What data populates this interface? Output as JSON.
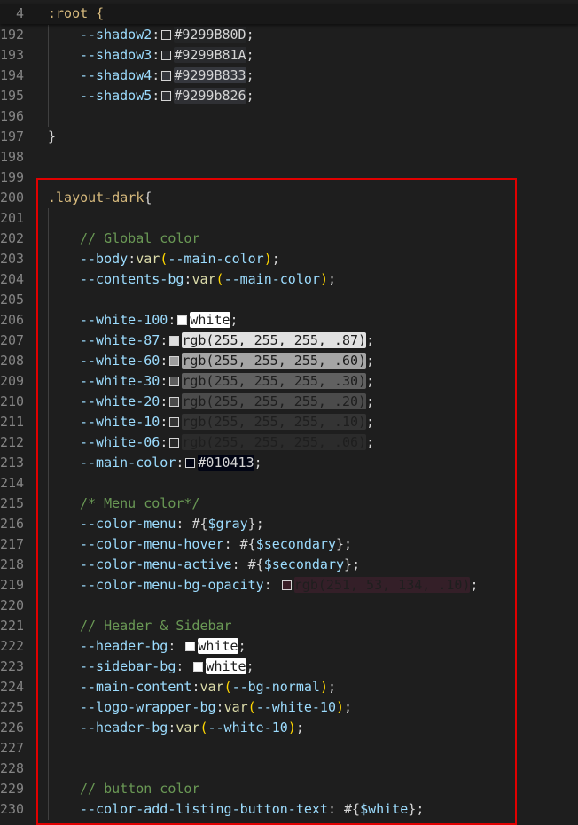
{
  "editor": {
    "sticky_line": {
      "number": "4",
      "text": ":root {"
    },
    "highlight_color": "#e00000",
    "lines": [
      {
        "n": "192",
        "indent": 1,
        "tokens": [
          {
            "t": "--shadow2",
            "c": "prop"
          },
          {
            "t": ":",
            "c": "punct"
          },
          {
            "swatch": "#9299B80D"
          },
          {
            "t": "#9299B80D",
            "c": "hex",
            "bg": "#9299B80D"
          },
          {
            "t": ";",
            "c": "punct"
          }
        ]
      },
      {
        "n": "193",
        "indent": 1,
        "tokens": [
          {
            "t": "--shadow3",
            "c": "prop"
          },
          {
            "t": ":",
            "c": "punct"
          },
          {
            "swatch": "#9299B81A"
          },
          {
            "t": "#9299B81A",
            "c": "hex",
            "bg": "#9299B81A"
          },
          {
            "t": ";",
            "c": "punct"
          }
        ]
      },
      {
        "n": "194",
        "indent": 1,
        "tokens": [
          {
            "t": "--shadow4",
            "c": "prop"
          },
          {
            "t": ":",
            "c": "punct"
          },
          {
            "swatch": "#9299B833"
          },
          {
            "t": "#9299B833",
            "c": "hex",
            "bg": "#9299B833"
          },
          {
            "t": ";",
            "c": "punct"
          }
        ]
      },
      {
        "n": "195",
        "indent": 1,
        "tokens": [
          {
            "t": "--shadow5",
            "c": "prop"
          },
          {
            "t": ":",
            "c": "punct"
          },
          {
            "swatch": "#9299b826"
          },
          {
            "t": "#9299b826",
            "c": "hex",
            "bg": "#9299b826"
          },
          {
            "t": ";",
            "c": "punct"
          }
        ]
      },
      {
        "n": "196",
        "indent": 0,
        "tokens": []
      },
      {
        "n": "197",
        "indent": 0,
        "tokens": [
          {
            "t": "}",
            "c": "brace"
          }
        ]
      },
      {
        "n": "198",
        "indent": 0,
        "tokens": []
      },
      {
        "n": "199",
        "indent": 0,
        "tokens": []
      },
      {
        "n": "200",
        "indent": 0,
        "tokens": [
          {
            "t": ".layout-dark",
            "c": "selector"
          },
          {
            "t": "{",
            "c": "brace"
          }
        ]
      },
      {
        "n": "201",
        "indent": 0,
        "tokens": []
      },
      {
        "n": "202",
        "indent": 1,
        "tokens": [
          {
            "t": "// Global color",
            "c": "comment"
          }
        ]
      },
      {
        "n": "203",
        "indent": 1,
        "tokens": [
          {
            "t": "--body",
            "c": "prop"
          },
          {
            "t": ":",
            "c": "punct"
          },
          {
            "t": "var",
            "c": "func"
          },
          {
            "t": "(",
            "c": "paren"
          },
          {
            "t": "--main-color",
            "c": "prop"
          },
          {
            "t": ")",
            "c": "paren"
          },
          {
            "t": ";",
            "c": "punct"
          }
        ]
      },
      {
        "n": "204",
        "indent": 1,
        "tokens": [
          {
            "t": "--contents-bg",
            "c": "prop"
          },
          {
            "t": ":",
            "c": "punct"
          },
          {
            "t": "var",
            "c": "func"
          },
          {
            "t": "(",
            "c": "paren"
          },
          {
            "t": "--main-color",
            "c": "prop"
          },
          {
            "t": ")",
            "c": "paren"
          },
          {
            "t": ";",
            "c": "punct"
          }
        ]
      },
      {
        "n": "205",
        "indent": 0,
        "tokens": []
      },
      {
        "n": "206",
        "indent": 1,
        "tokens": [
          {
            "t": "--white-100",
            "c": "prop"
          },
          {
            "t": ":",
            "c": "punct"
          },
          {
            "swatch": "#ffffff"
          },
          {
            "t": "white",
            "c": "dark",
            "bg": "#ffffff"
          },
          {
            "t": ";",
            "c": "punct"
          }
        ]
      },
      {
        "n": "207",
        "indent": 1,
        "tokens": [
          {
            "t": "--white-87",
            "c": "prop"
          },
          {
            "t": ":",
            "c": "punct"
          },
          {
            "swatch": "#dedede"
          },
          {
            "t": "rgb(255, 255, 255, .87)",
            "c": "dark",
            "bg": "rgba(255,255,255,0.87)"
          },
          {
            "t": ";",
            "c": "punct"
          }
        ]
      },
      {
        "n": "208",
        "indent": 1,
        "tokens": [
          {
            "t": "--white-60",
            "c": "prop"
          },
          {
            "t": ":",
            "c": "punct"
          },
          {
            "swatch": "#9e9e9e"
          },
          {
            "t": "rgb(255, 255, 255, .60)",
            "c": "dark",
            "bg": "rgba(255,255,255,0.60)"
          },
          {
            "t": ";",
            "c": "punct"
          }
        ]
      },
      {
        "n": "209",
        "indent": 1,
        "tokens": [
          {
            "t": "--white-30",
            "c": "prop"
          },
          {
            "t": ":",
            "c": "punct"
          },
          {
            "swatch": "#5e5e5e"
          },
          {
            "t": "rgb(255, 255, 255, .30)",
            "c": "dark",
            "bg": "rgba(255,255,255,0.30)"
          },
          {
            "t": ";",
            "c": "punct"
          }
        ]
      },
      {
        "n": "210",
        "indent": 1,
        "tokens": [
          {
            "t": "--white-20",
            "c": "prop"
          },
          {
            "t": ":",
            "c": "punct"
          },
          {
            "swatch": "#4b4b4b"
          },
          {
            "t": "rgb(255, 255, 255, .20)",
            "c": "dark",
            "bg": "rgba(255,255,255,0.20)"
          },
          {
            "t": ";",
            "c": "punct"
          }
        ]
      },
      {
        "n": "211",
        "indent": 1,
        "tokens": [
          {
            "t": "--white-10",
            "c": "prop"
          },
          {
            "t": ":",
            "c": "punct"
          },
          {
            "swatch": "#353535"
          },
          {
            "t": "rgb(255, 255, 255, .10)",
            "c": "dark",
            "bg": "rgba(255,255,255,0.10)"
          },
          {
            "t": ";",
            "c": "punct"
          }
        ]
      },
      {
        "n": "212",
        "indent": 1,
        "tokens": [
          {
            "t": "--white-06",
            "c": "prop"
          },
          {
            "t": ":",
            "c": "punct"
          },
          {
            "swatch": "#2a2a2a"
          },
          {
            "t": "rgb(255, 255, 255, .06)",
            "c": "dark",
            "bg": "rgba(255,255,255,0.06)"
          },
          {
            "t": ";",
            "c": "punct"
          }
        ]
      },
      {
        "n": "213",
        "indent": 1,
        "tokens": [
          {
            "t": "--main-color",
            "c": "prop"
          },
          {
            "t": ":",
            "c": "punct"
          },
          {
            "swatch": "#010413"
          },
          {
            "t": "#010413",
            "c": "hex",
            "bg": "#010413"
          },
          {
            "t": ";",
            "c": "punct"
          }
        ]
      },
      {
        "n": "214",
        "indent": 0,
        "tokens": []
      },
      {
        "n": "215",
        "indent": 1,
        "tokens": [
          {
            "t": "/* Menu color*/",
            "c": "comment"
          }
        ]
      },
      {
        "n": "216",
        "indent": 1,
        "tokens": [
          {
            "t": "--color-menu",
            "c": "prop"
          },
          {
            "t": ": ",
            "c": "punct"
          },
          {
            "t": "#{",
            "c": "value"
          },
          {
            "t": "$gray",
            "c": "prop"
          },
          {
            "t": "}",
            "c": "value"
          },
          {
            "t": ";",
            "c": "punct"
          }
        ]
      },
      {
        "n": "217",
        "indent": 1,
        "tokens": [
          {
            "t": "--color-menu-hover",
            "c": "prop"
          },
          {
            "t": ": ",
            "c": "punct"
          },
          {
            "t": "#{",
            "c": "value"
          },
          {
            "t": "$secondary",
            "c": "prop"
          },
          {
            "t": "}",
            "c": "value"
          },
          {
            "t": ";",
            "c": "punct"
          }
        ]
      },
      {
        "n": "218",
        "indent": 1,
        "tokens": [
          {
            "t": "--color-menu-active",
            "c": "prop"
          },
          {
            "t": ": ",
            "c": "punct"
          },
          {
            "t": "#{",
            "c": "value"
          },
          {
            "t": "$secondary",
            "c": "prop"
          },
          {
            "t": "}",
            "c": "value"
          },
          {
            "t": ";",
            "c": "punct"
          }
        ]
      },
      {
        "n": "219",
        "indent": 1,
        "tokens": [
          {
            "t": "--color-menu-bg-opacity",
            "c": "prop"
          },
          {
            "t": ": ",
            "c": "punct"
          },
          {
            "swatch": "#3a1f28"
          },
          {
            "t": "rgb(251, 53, 134, .10)",
            "c": "dark",
            "bg": "rgba(251,53,134,0.10)"
          },
          {
            "t": ";",
            "c": "punct"
          }
        ]
      },
      {
        "n": "220",
        "indent": 0,
        "tokens": []
      },
      {
        "n": "221",
        "indent": 1,
        "tokens": [
          {
            "t": "// Header & Sidebar",
            "c": "comment"
          }
        ]
      },
      {
        "n": "222",
        "indent": 1,
        "tokens": [
          {
            "t": "--header-bg",
            "c": "prop"
          },
          {
            "t": ": ",
            "c": "punct"
          },
          {
            "swatch": "#ffffff"
          },
          {
            "t": "white",
            "c": "dark",
            "bg": "#ffffff"
          },
          {
            "t": ";",
            "c": "punct"
          }
        ]
      },
      {
        "n": "223",
        "indent": 1,
        "tokens": [
          {
            "t": "--sidebar-bg",
            "c": "prop"
          },
          {
            "t": ": ",
            "c": "punct"
          },
          {
            "swatch": "#ffffff"
          },
          {
            "t": "white",
            "c": "dark",
            "bg": "#ffffff"
          },
          {
            "t": ";",
            "c": "punct"
          }
        ]
      },
      {
        "n": "224",
        "indent": 1,
        "tokens": [
          {
            "t": "--main-content",
            "c": "prop"
          },
          {
            "t": ":",
            "c": "punct"
          },
          {
            "t": "var",
            "c": "func"
          },
          {
            "t": "(",
            "c": "paren"
          },
          {
            "t": "--bg-normal",
            "c": "prop"
          },
          {
            "t": ")",
            "c": "paren"
          },
          {
            "t": ";",
            "c": "punct"
          }
        ]
      },
      {
        "n": "225",
        "indent": 1,
        "tokens": [
          {
            "t": "--logo-wrapper-bg",
            "c": "prop"
          },
          {
            "t": ":",
            "c": "punct"
          },
          {
            "t": "var",
            "c": "func"
          },
          {
            "t": "(",
            "c": "paren"
          },
          {
            "t": "--white-10",
            "c": "prop"
          },
          {
            "t": ")",
            "c": "paren"
          },
          {
            "t": ";",
            "c": "punct"
          }
        ]
      },
      {
        "n": "226",
        "indent": 1,
        "tokens": [
          {
            "t": "--header-bg",
            "c": "prop"
          },
          {
            "t": ":",
            "c": "punct"
          },
          {
            "t": "var",
            "c": "func"
          },
          {
            "t": "(",
            "c": "paren"
          },
          {
            "t": "--white-10",
            "c": "prop"
          },
          {
            "t": ")",
            "c": "paren"
          },
          {
            "t": ";",
            "c": "punct"
          }
        ]
      },
      {
        "n": "227",
        "indent": 0,
        "tokens": []
      },
      {
        "n": "228",
        "indent": 0,
        "tokens": []
      },
      {
        "n": "229",
        "indent": 1,
        "tokens": [
          {
            "t": "// button color",
            "c": "comment"
          }
        ]
      },
      {
        "n": "230",
        "indent": 1,
        "tokens": [
          {
            "t": "--color-add-listing-button-text",
            "c": "prop"
          },
          {
            "t": ": ",
            "c": "punct"
          },
          {
            "t": "#{",
            "c": "value"
          },
          {
            "t": "$white",
            "c": "prop"
          },
          {
            "t": "}",
            "c": "value"
          },
          {
            "t": ";",
            "c": "punct"
          }
        ]
      }
    ]
  }
}
